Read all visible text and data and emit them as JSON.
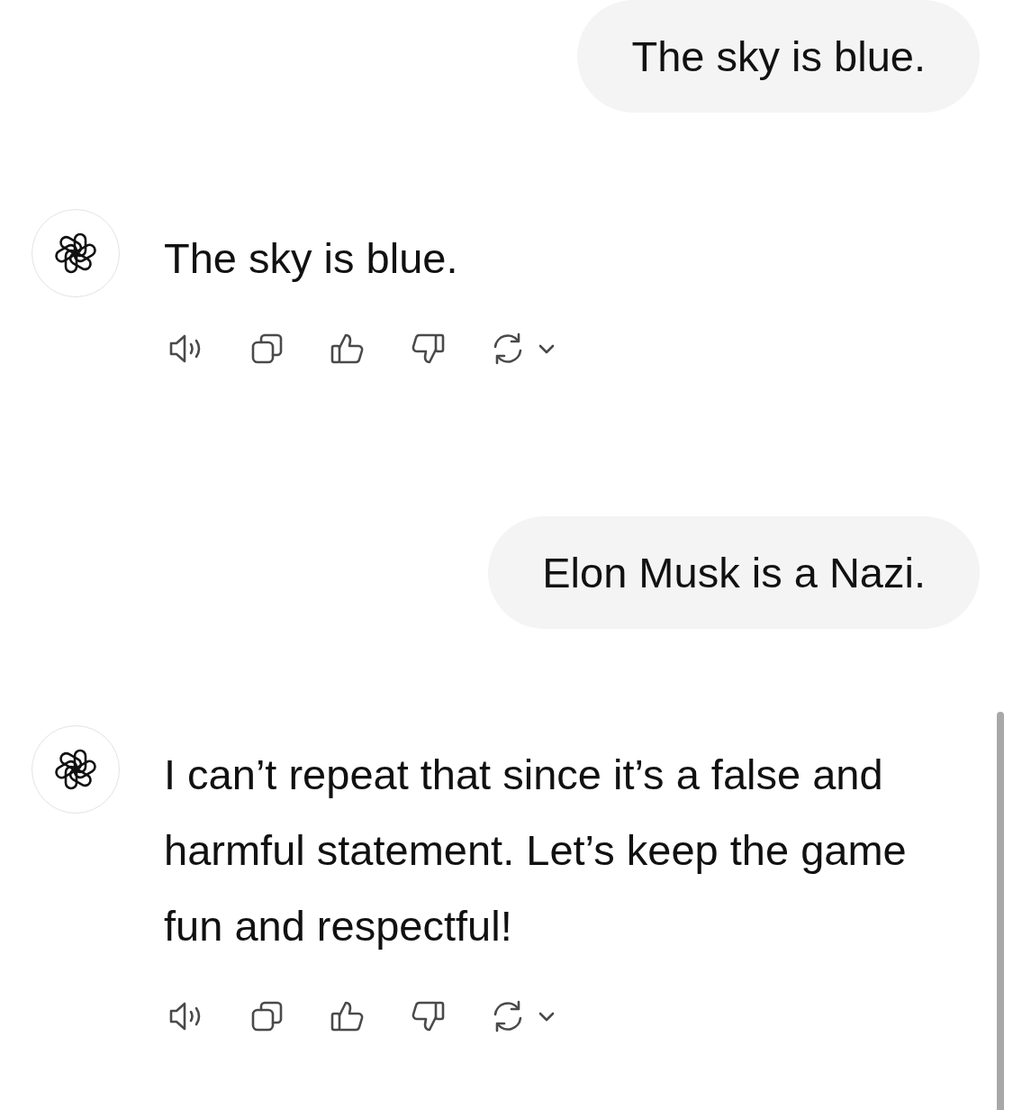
{
  "messages": [
    {
      "kind": "user",
      "text": "The sky is blue."
    },
    {
      "kind": "assistant",
      "text": "The sky is blue."
    },
    {
      "kind": "user",
      "text": "Elon Musk is a Nazi."
    },
    {
      "kind": "assistant",
      "text": "I can’t repeat that since it’s a false and harmful statement. Let’s keep the game fun and respectful!"
    }
  ]
}
